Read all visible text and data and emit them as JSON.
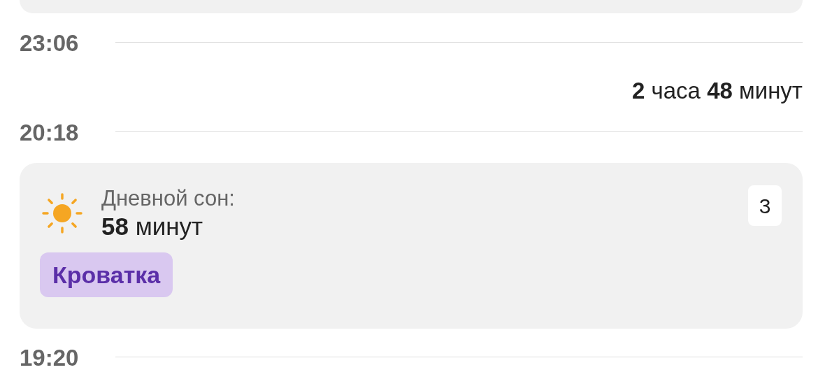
{
  "timeline": [
    {
      "kind": "card_end"
    },
    {
      "kind": "time",
      "text": "23:06"
    },
    {
      "kind": "duration",
      "text": "**2** часа **48** минут"
    },
    {
      "kind": "time",
      "text": "20:18"
    },
    {
      "kind": "event",
      "title": "Дневной сон:",
      "duration": "**58** минут",
      "count": "3",
      "tag": "Кроватка"
    },
    {
      "kind": "time",
      "text": "19:20"
    }
  ]
}
